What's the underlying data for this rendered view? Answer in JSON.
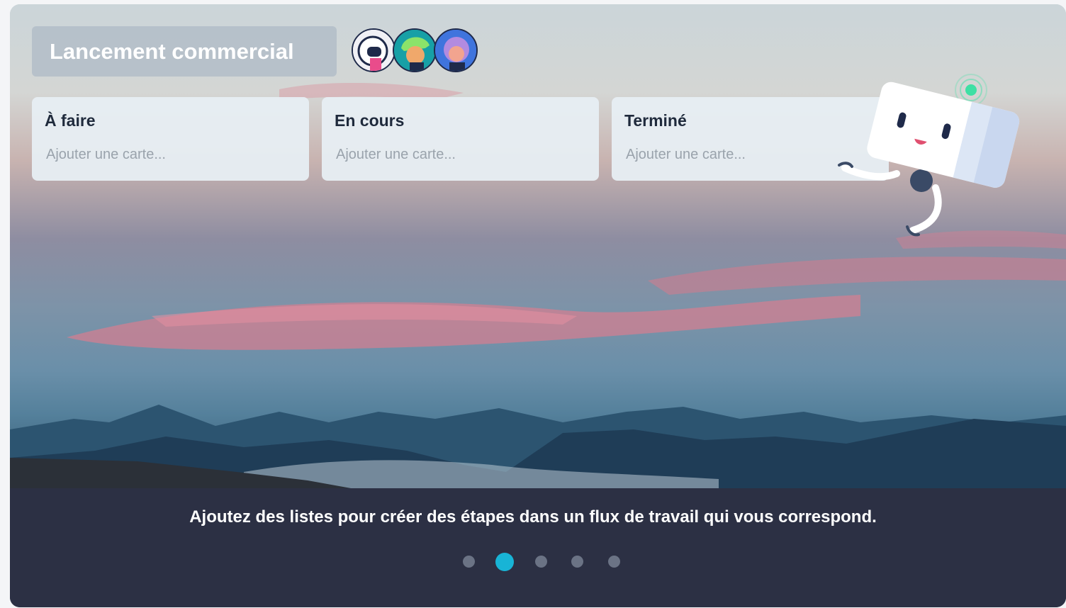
{
  "board": {
    "title": "Lancement commercial",
    "members": [
      {
        "icon": "avatar-astronaut"
      },
      {
        "icon": "avatar-green-hair"
      },
      {
        "icon": "avatar-purple-hair"
      }
    ]
  },
  "lists": [
    {
      "title": "À faire",
      "add_placeholder": "Ajouter une carte..."
    },
    {
      "title": "En cours",
      "add_placeholder": "Ajouter une carte..."
    },
    {
      "title": "Terminé",
      "add_placeholder": "Ajouter une carte..."
    }
  ],
  "caption": "Ajoutez des listes pour créer des étapes dans un flux de travail qui vous correspond.",
  "carousel": {
    "pages": 5,
    "active_index": 1
  },
  "colors": {
    "accent": "#18b4d6",
    "caption_band": "#2c3044"
  }
}
